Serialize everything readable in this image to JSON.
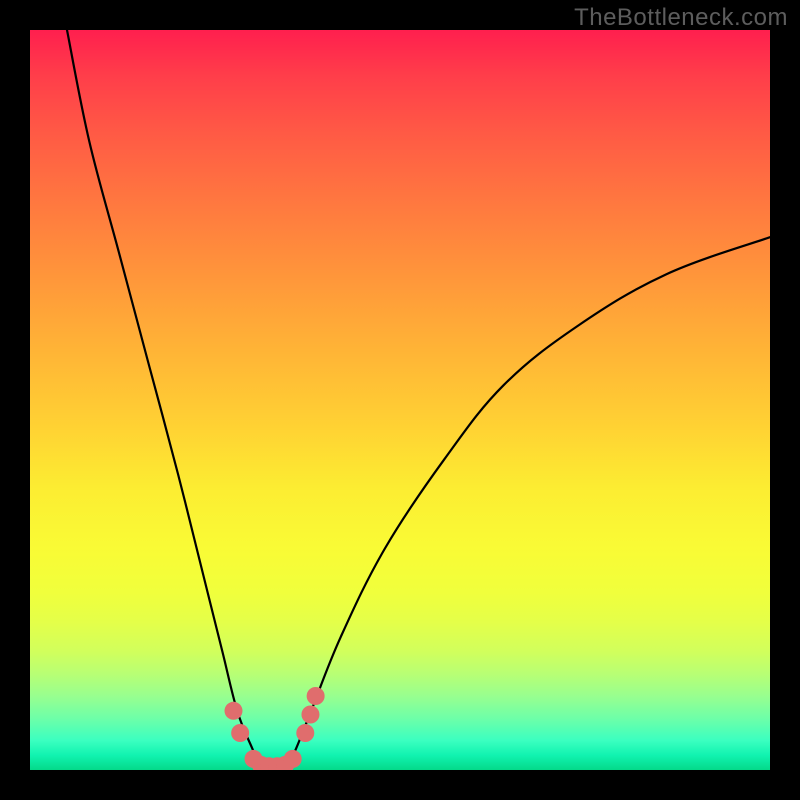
{
  "watermark": "TheBottleneck.com",
  "chart_data": {
    "type": "line",
    "title": "",
    "xlabel": "",
    "ylabel": "",
    "xlim": [
      0,
      100
    ],
    "ylim": [
      0,
      100
    ],
    "grid": false,
    "series": [
      {
        "name": "bottleneck-curve",
        "x": [
          5,
          8,
          12,
          16,
          20,
          24,
          26,
          28,
          30,
          31,
          32,
          33,
          34,
          35,
          36,
          38,
          42,
          48,
          56,
          64,
          74,
          86,
          100
        ],
        "y": [
          100,
          85,
          70,
          55,
          40,
          24,
          16,
          8,
          3,
          1,
          0,
          0,
          0,
          1,
          3,
          8,
          18,
          30,
          42,
          52,
          60,
          67,
          72
        ]
      }
    ],
    "markers": {
      "name": "highlight-band",
      "color": "#e06d6d",
      "points": [
        {
          "x": 27.5,
          "y": 8
        },
        {
          "x": 28.4,
          "y": 5
        },
        {
          "x": 30.2,
          "y": 1.5
        },
        {
          "x": 31.2,
          "y": 0.7
        },
        {
          "x": 32.3,
          "y": 0.5
        },
        {
          "x": 33.4,
          "y": 0.5
        },
        {
          "x": 34.5,
          "y": 0.7
        },
        {
          "x": 35.5,
          "y": 1.5
        },
        {
          "x": 37.2,
          "y": 5
        },
        {
          "x": 37.9,
          "y": 7.5
        },
        {
          "x": 38.6,
          "y": 10
        }
      ]
    },
    "background_gradient": {
      "top": "#ff1f4e",
      "upper_mid": "#ff983a",
      "mid": "#fced32",
      "lower_mid": "#98ff8f",
      "bottom": "#04d989"
    }
  }
}
